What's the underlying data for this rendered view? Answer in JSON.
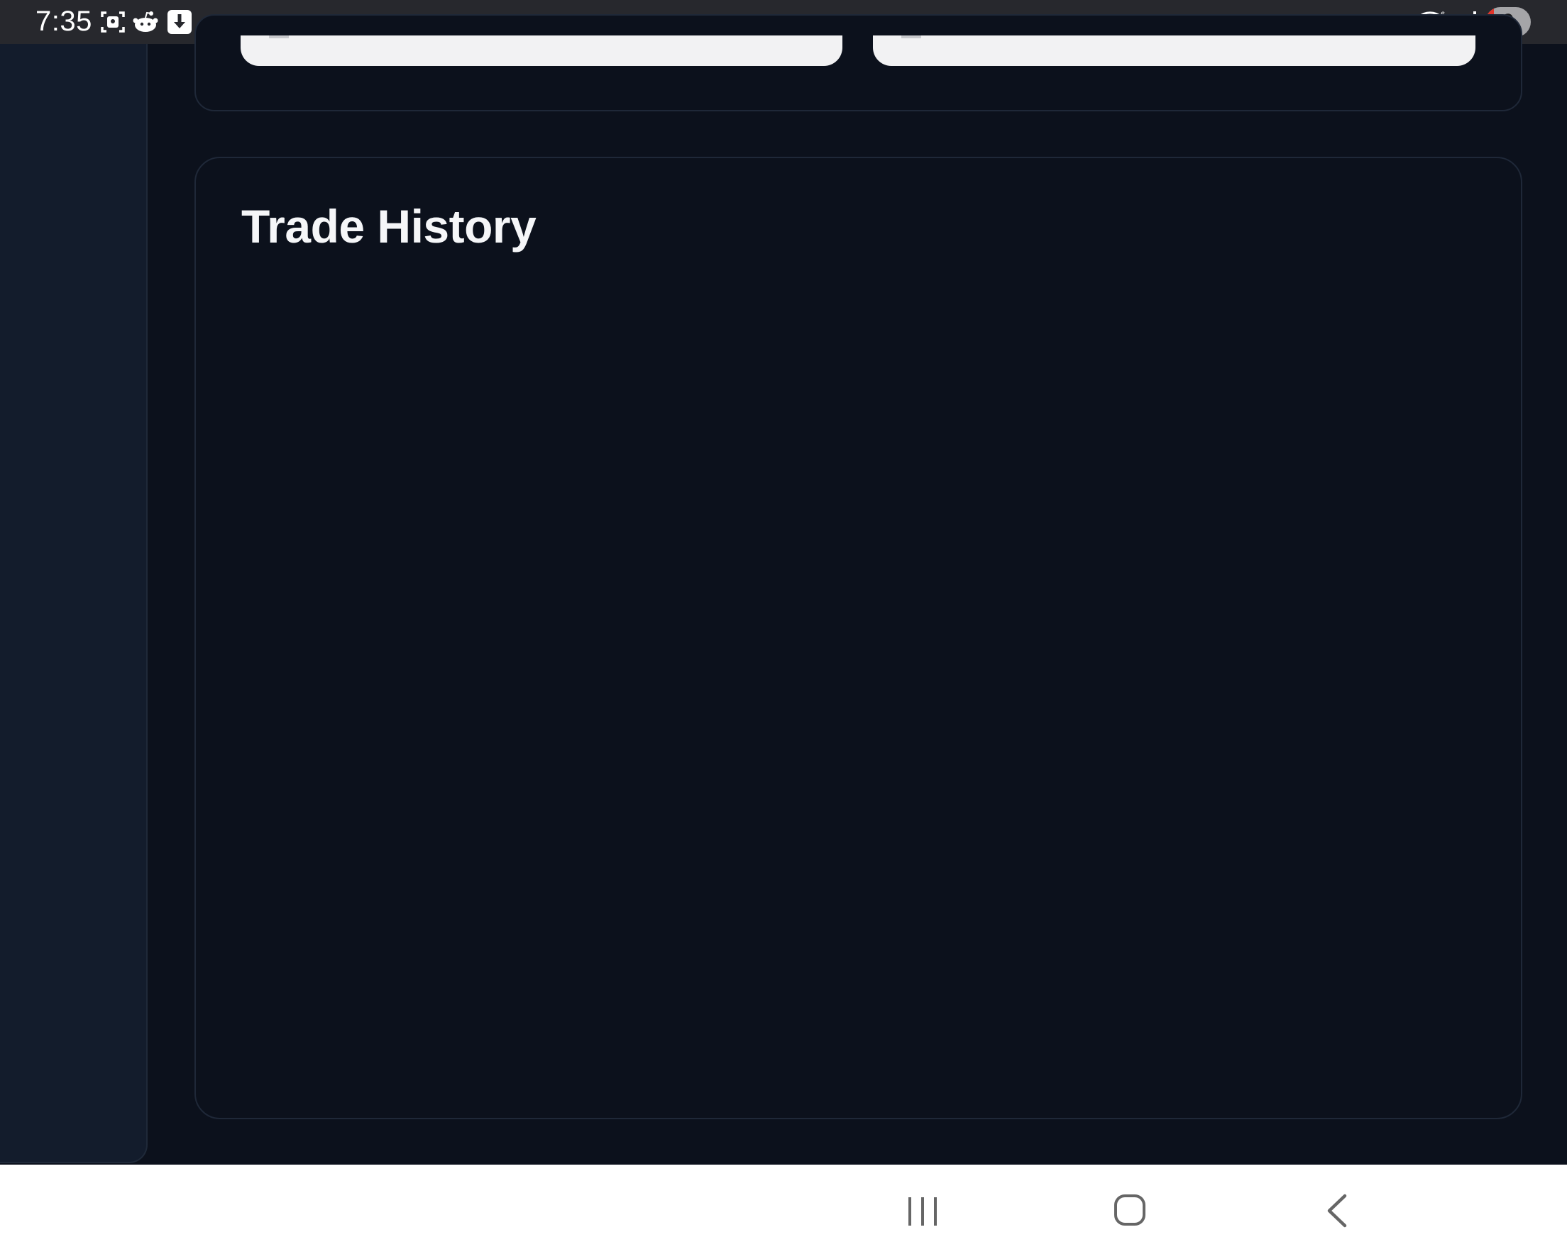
{
  "status_bar": {
    "time": "7:35",
    "battery_level": "9",
    "left_icons": [
      "screenshot-icon",
      "reddit-icon",
      "download-icon",
      "notification-dot-icon"
    ],
    "right_icons": [
      "wifi-6-icon",
      "signal-icon",
      "battery-icon"
    ],
    "colors": {
      "background": "#27282d",
      "battery_low": "#e2352a"
    }
  },
  "main": {
    "trade_history": {
      "title": "Trade History"
    }
  },
  "nav_bar": {
    "buttons": [
      "recent-apps-icon",
      "home-icon",
      "back-icon"
    ]
  },
  "theme": {
    "page_background": "#0c111c",
    "sidebar_background": "#131c2c",
    "card_border": "#1f2838",
    "text": "#f5f6f8"
  }
}
